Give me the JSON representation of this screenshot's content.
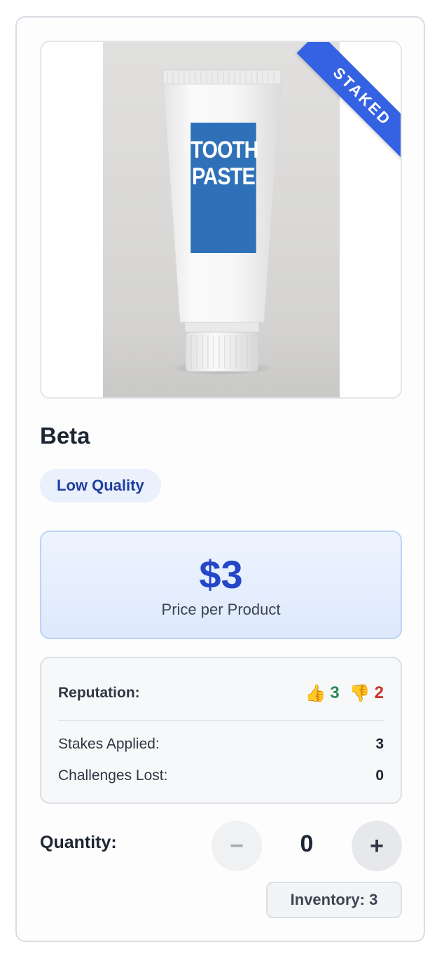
{
  "product": {
    "ribbon": "STAKED",
    "label_line1": "TOOTH",
    "label_line2": "PASTE",
    "name": "Beta",
    "quality": "Low Quality"
  },
  "price": {
    "value": "$3",
    "caption": "Price per Product"
  },
  "stats": {
    "reputation_label": "Reputation:",
    "thumbs_up": "3",
    "thumbs_down": "2",
    "stakes_label": "Stakes Applied:",
    "stakes_value": "3",
    "lost_label": "Challenges Lost:",
    "lost_value": "0"
  },
  "quantity": {
    "label": "Quantity:",
    "minus": "−",
    "value": "0",
    "plus": "+"
  },
  "inventory": {
    "text": "Inventory: 3"
  },
  "icons": {
    "thumbs_up": "thumbs-up-icon",
    "thumbs_down": "thumbs-down-icon"
  },
  "colors": {
    "accent": "#2446c8",
    "ribbon": "#3562e3",
    "up": "#2e8b57",
    "down": "#c8322b"
  }
}
